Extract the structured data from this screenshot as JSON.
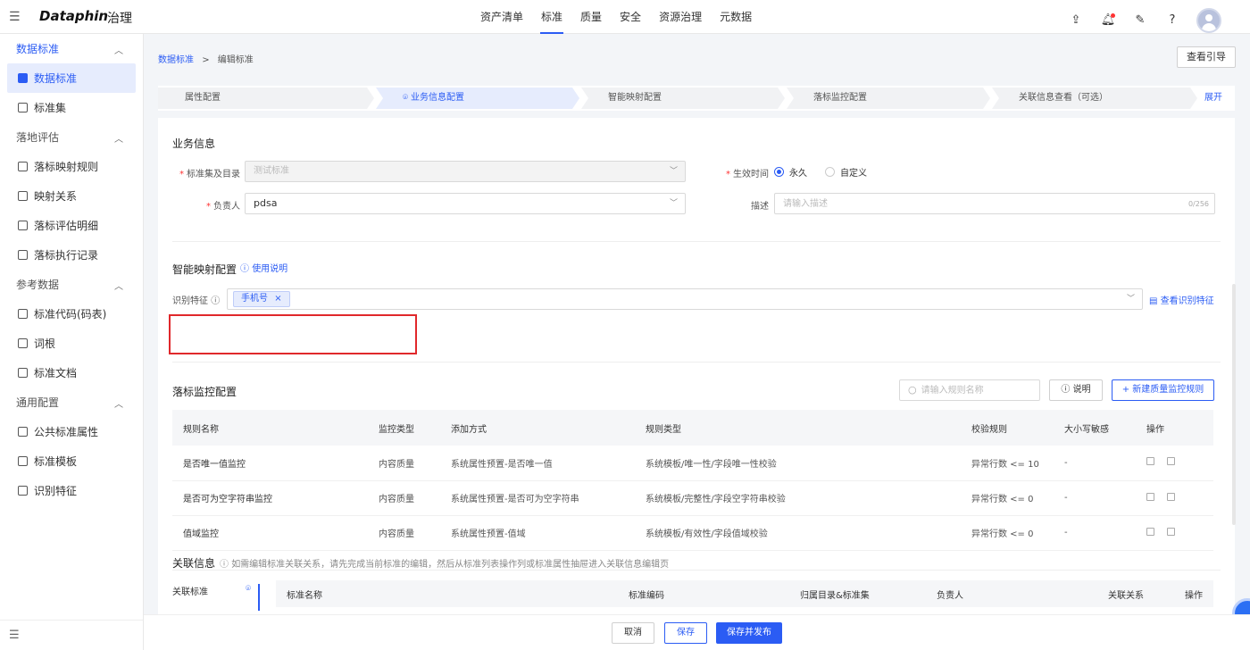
{
  "app": {
    "brand": "Dataphin",
    "module": "治理"
  },
  "topnav": [
    "资产清单",
    "标准",
    "质量",
    "安全",
    "资源治理",
    "元数据"
  ],
  "topnav_active": 1,
  "header_icons": [
    "upload-icon",
    "bell-icon",
    "wrench-icon",
    "help-icon",
    "avatar"
  ],
  "sidebar": {
    "groups": [
      {
        "label": "数据标准",
        "items": [
          "数据标准",
          "标准集"
        ]
      },
      {
        "label": "落地评估",
        "items": [
          "落标映射规则",
          "映射关系",
          "落标评估明细",
          "落标执行记录"
        ]
      },
      {
        "label": "参考数据",
        "items": [
          "标准代码(码表)",
          "词根",
          "标准文档"
        ]
      },
      {
        "label": "通用配置",
        "items": [
          "公共标准属性",
          "标准模板",
          "识别特征"
        ]
      }
    ]
  },
  "breadcrumb": {
    "parent": "数据标准",
    "sep": ">",
    "current": "编辑标准"
  },
  "guide_button": "查看引导",
  "steps": [
    "属性配置",
    "业务信息配置",
    "智能映射配置",
    "落标监控配置",
    "关联信息查看（可选）"
  ],
  "steps_active": 1,
  "expand": "展开",
  "business": {
    "title": "业务信息",
    "catalog_label": "标准集及目录",
    "catalog_value": "测试标准",
    "owner_label": "负责人",
    "owner_value": "pdsa",
    "effect_label": "生效时间",
    "effect_options": [
      "永久",
      "自定义"
    ],
    "effect_selected": 0,
    "desc_label": "描述",
    "desc_placeholder": "请输入描述",
    "desc_counter": "0/256"
  },
  "mapping": {
    "title": "智能映射配置",
    "help_link": "使用说明",
    "feature_label": "识别特征",
    "tags": [
      "手机号"
    ],
    "view_link": "查看识别特征"
  },
  "monitor": {
    "title": "落标监控配置",
    "search_placeholder": "请输入规则名称",
    "explain_button": "说明",
    "new_button": "+ 新建质量监控规则",
    "columns": [
      "规则名称",
      "监控类型",
      "添加方式",
      "规则类型",
      "校验规则",
      "大小写敏感",
      "操作"
    ],
    "rows": [
      [
        "是否唯一值监控",
        "内容质量",
        "系统属性预置-是否唯一值",
        "系统模板/唯一性/字段唯一性校验",
        "异常行数 <= 10",
        "-"
      ],
      [
        "是否可为空字符串监控",
        "内容质量",
        "系统属性预置-是否可为空字符串",
        "系统模板/完整性/字段空字符串校验",
        "异常行数 <= 0",
        "-"
      ],
      [
        "值域监控",
        "内容质量",
        "系统属性预置-值域",
        "系统模板/有效性/字段值域校验",
        "异常行数 <= 0",
        "-"
      ]
    ]
  },
  "relation": {
    "title": "关联信息",
    "note": "如需编辑标准关联关系，请先完成当前标准的编辑，然后从标准列表操作列或标准属性抽屉进入关联信息编辑页",
    "tabs": [
      "关联标准"
    ],
    "columns": [
      "标准名称",
      "标准编码",
      "归属目录&标准集",
      "负责人",
      "关联关系",
      "操作"
    ]
  },
  "footer": {
    "cancel": "取消",
    "save": "保存",
    "save_publish": "保存并发布"
  }
}
